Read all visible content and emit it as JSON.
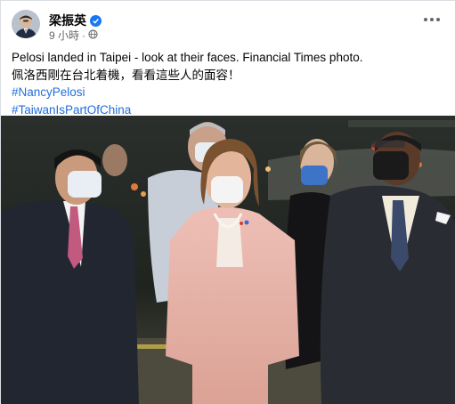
{
  "post": {
    "author": "梁振英",
    "time": "9 小時",
    "text_line_1": "Pelosi landed in Taipei - look at their faces. Financial Times photo.",
    "text_line_2": "佩洛西剛在台北着機，看看這些人的面容！",
    "hashtags": [
      "#NancyPelosi",
      "#TaiwanIsPartOfChina"
    ]
  },
  "icons": {
    "verified": "verified-badge-icon",
    "audience": "globe-icon",
    "more": "more-options-icon"
  },
  "colors": {
    "link": "#216fdb",
    "verified": "#1877f2",
    "meta": "#65676b"
  }
}
